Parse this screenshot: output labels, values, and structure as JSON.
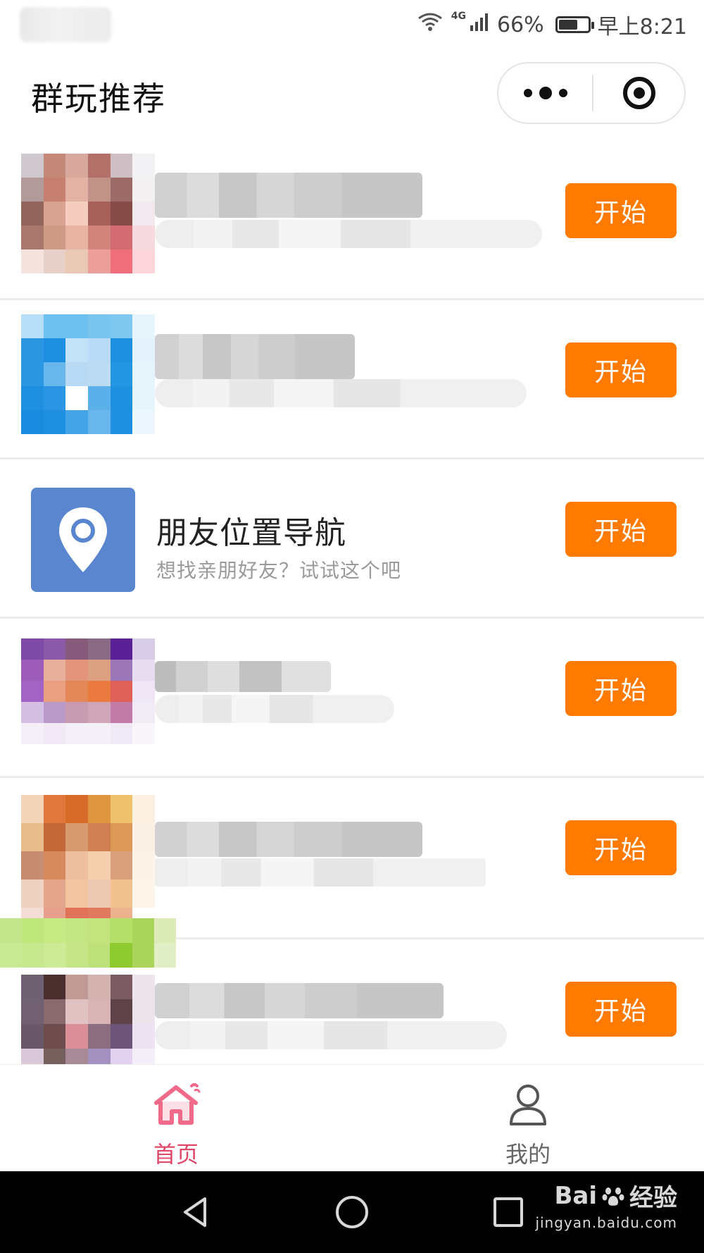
{
  "status_bar": {
    "network": "4G",
    "battery_percent": "66%",
    "battery_level": 0.66,
    "time": "早上8:21"
  },
  "header": {
    "title": "群玩推荐"
  },
  "list": {
    "start_label": "开始",
    "location_item": {
      "name": "朋友位置导航",
      "description": "想找亲朋好友？试试这个吧"
    }
  },
  "tabbar": {
    "home_label": "首页",
    "mine_label": "我的",
    "active_color": "#e0486a",
    "inactive_color": "#666666"
  },
  "watermark": {
    "brand": "Bai",
    "brand_suffix": "经验",
    "url": "jingyan.baidu.com"
  },
  "colors": {
    "accent": "#ff7a00",
    "location_icon_bg": "#5a86cf"
  }
}
